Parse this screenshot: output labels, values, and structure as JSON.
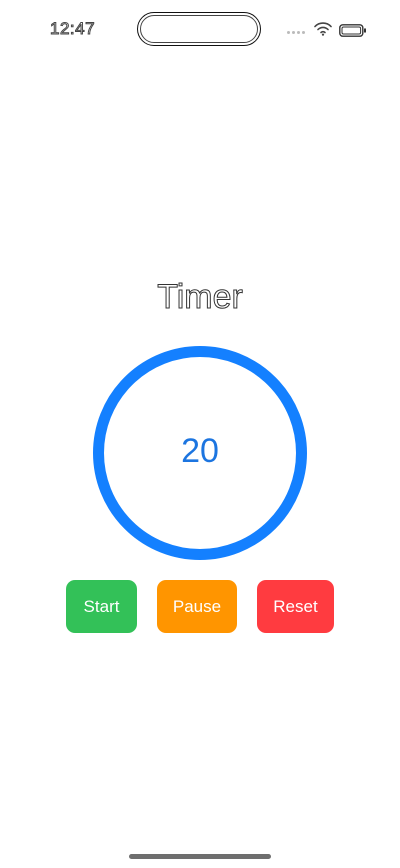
{
  "status_bar": {
    "time": "12:47",
    "signal_icon": "signal-dots-icon",
    "wifi_icon": "wifi-icon",
    "battery_icon": "battery-icon"
  },
  "main": {
    "title": "Timer",
    "timer_value": "20",
    "ring_color": "#1480ff"
  },
  "controls": {
    "start_label": "Start",
    "pause_label": "Pause",
    "reset_label": "Reset",
    "start_color": "#33c158",
    "pause_color": "#ff9500",
    "reset_color": "#ff3b40"
  }
}
